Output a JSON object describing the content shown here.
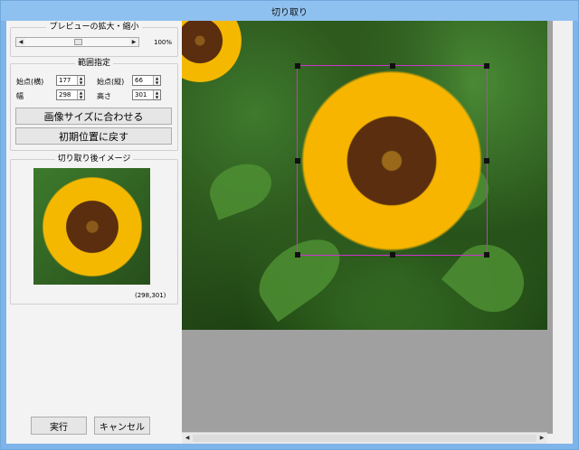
{
  "window": {
    "title": "切り取り"
  },
  "preview_zoom": {
    "legend": "プレビューの拡大・縮小",
    "percent_label": "100%",
    "level": 0.5
  },
  "range": {
    "legend": "範囲指定",
    "start_x_label": "始点(横)",
    "start_x_value": "177",
    "start_y_label": "始点(縦)",
    "start_y_value": "66",
    "width_label": "幅",
    "width_value": "298",
    "height_label": "高さ",
    "height_value": "301"
  },
  "buttons": {
    "fit_image_size": "画像サイズに合わせる",
    "reset_position": "初期位置に戻す",
    "execute": "実行",
    "cancel": "キャンセル"
  },
  "preview_after": {
    "legend": "切り取り後イメージ",
    "size_text": "(298,301)"
  },
  "icons": {
    "arrow_left": "arrow-left-icon",
    "arrow_right": "arrow-right-icon",
    "spin_up": "spin-up-icon",
    "spin_down": "spin-down-icon"
  },
  "colors": {
    "crop_frame": "#cc33cc",
    "titlebar": "#8fc1f0",
    "canvas_empty": "#a0a0a0"
  }
}
